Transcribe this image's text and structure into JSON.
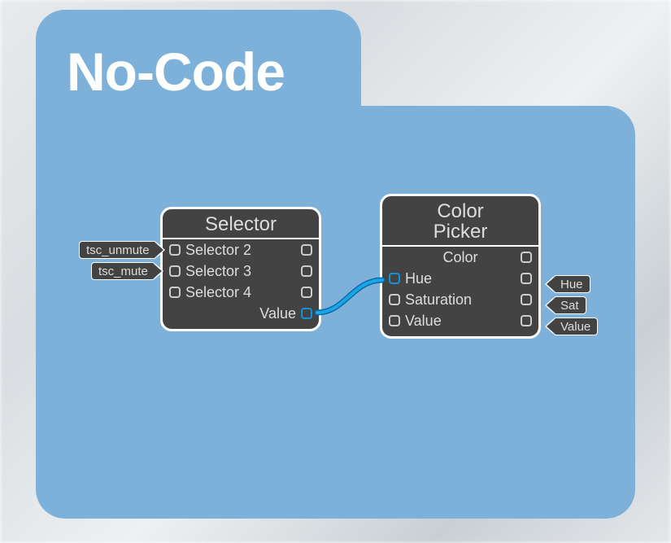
{
  "title": "No-Code",
  "colors": {
    "panel": "#7db1da",
    "node_bg": "#434343",
    "node_border": "#ffffff",
    "wire": "#1094d7"
  },
  "nodes": {
    "selector": {
      "title": "Selector",
      "rows": [
        {
          "label": "Selector 2",
          "in": true,
          "out": true
        },
        {
          "label": "Selector 3",
          "in": true,
          "out": true
        },
        {
          "label": "Selector 4",
          "in": true,
          "out": true
        },
        {
          "label": "Value",
          "in": false,
          "out": true
        }
      ]
    },
    "color_picker": {
      "title": "Color\nPicker",
      "rows": [
        {
          "label": "Color",
          "in": false,
          "out": true
        },
        {
          "label": "Hue",
          "in": true,
          "out": true
        },
        {
          "label": "Saturation",
          "in": true,
          "out": true
        },
        {
          "label": "Value",
          "in": true,
          "out": true
        }
      ]
    }
  },
  "tags": {
    "left": [
      {
        "text": "tsc_unmute"
      },
      {
        "text": "tsc_mute"
      }
    ],
    "right": [
      {
        "text": "Hue"
      },
      {
        "text": "Sat"
      },
      {
        "text": "Value"
      }
    ]
  },
  "connections": [
    {
      "from": "selector.Value.out",
      "to": "color_picker.Hue.in"
    }
  ]
}
